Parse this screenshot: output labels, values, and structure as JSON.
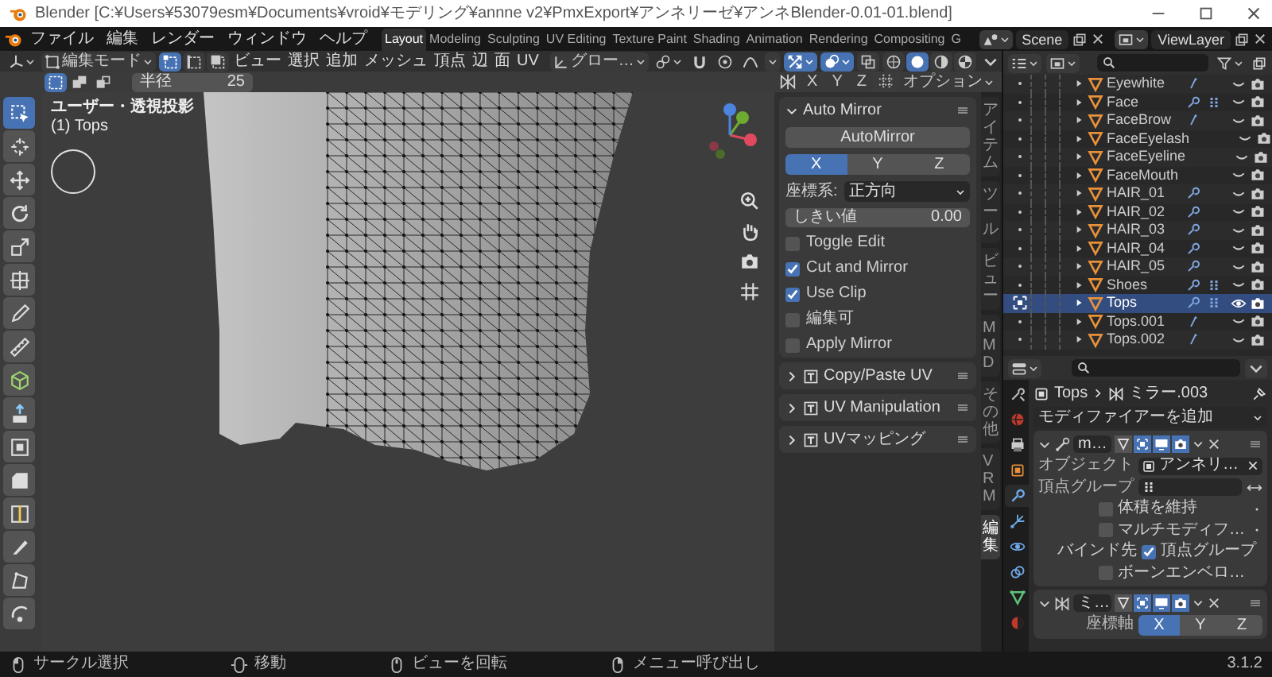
{
  "window": {
    "title": "Blender [C:¥Users¥53079esm¥Documents¥vroid¥モデリング¥annne v2¥PmxExport¥アンネリーゼ¥アンネBlender-0.01-01.blend]"
  },
  "menu": [
    "ファイル",
    "編集",
    "レンダー",
    "ウィンドウ",
    "ヘルプ"
  ],
  "workspaces": [
    {
      "label": "Layout",
      "selected": true
    },
    {
      "label": "Modeling",
      "selected": false
    },
    {
      "label": "Sculpting",
      "selected": false
    },
    {
      "label": "UV Editing",
      "selected": false
    },
    {
      "label": "Texture Paint",
      "selected": false
    },
    {
      "label": "Shading",
      "selected": false
    },
    {
      "label": "Animation",
      "selected": false
    },
    {
      "label": "Rendering",
      "selected": false
    },
    {
      "label": "Compositing",
      "selected": false
    },
    {
      "label": "G",
      "selected": false
    }
  ],
  "scene": "Scene",
  "view_layer": "ViewLayer",
  "viewport": {
    "mode": "編集モード",
    "select_modes": [
      {
        "kind": "vertex",
        "selected": true
      },
      {
        "kind": "edge",
        "selected": false
      },
      {
        "kind": "face",
        "selected": false
      }
    ],
    "menus": [
      "ビュー",
      "選択",
      "追加",
      "メッシュ",
      "頂点",
      "辺",
      "面",
      "UV"
    ],
    "orientation": "グロー…",
    "toggles": [
      {
        "kind": "visibility",
        "on": false
      },
      {
        "kind": "gizmo",
        "on": true
      },
      {
        "kind": "overlay",
        "on": true
      },
      {
        "kind": "xray",
        "on": false
      }
    ],
    "shading": [
      {
        "kind": "wireframe",
        "selected": false
      },
      {
        "kind": "solid",
        "selected": true
      },
      {
        "kind": "material",
        "selected": false
      },
      {
        "kind": "rendered",
        "selected": false
      }
    ],
    "box_modes": [
      {
        "kind": "new",
        "selected": true
      },
      {
        "kind": "extend",
        "selected": false
      },
      {
        "kind": "subtract",
        "selected": false
      }
    ],
    "radius": {
      "label": "半径",
      "value": "25"
    },
    "mirror_axes": [
      "X",
      "Y",
      "Z"
    ],
    "options": "オプション",
    "view_name": "ユーザー・透視投影",
    "object_name": "(1) Tops",
    "tools": [
      {
        "kind": "select-box",
        "selected": true
      },
      {
        "kind": "cursor",
        "selected": false
      },
      {
        "kind": "move",
        "selected": false
      },
      {
        "kind": "rotate",
        "selected": false
      },
      {
        "kind": "scale",
        "selected": false
      },
      {
        "kind": "transform",
        "selected": false
      },
      {
        "kind": "annotate",
        "selected": false
      },
      {
        "kind": "measure",
        "selected": false
      },
      {
        "kind": "add-cube",
        "selected": false
      },
      {
        "kind": "extrude",
        "selected": false
      },
      {
        "kind": "inset",
        "selected": false
      },
      {
        "kind": "bevel",
        "selected": false
      },
      {
        "kind": "loop-cut",
        "selected": false
      },
      {
        "kind": "knife",
        "selected": false
      },
      {
        "kind": "poly-build",
        "selected": false
      },
      {
        "kind": "spin",
        "selected": false
      }
    ]
  },
  "sidebar_tabs": [
    {
      "label": "アイテム",
      "selected": false
    },
    {
      "label": "ツール",
      "selected": false
    },
    {
      "label": "ビュー",
      "selected": false
    },
    {
      "label": "MMD",
      "selected": false
    },
    {
      "label": "その他",
      "selected": false
    },
    {
      "label": "VRM",
      "selected": false
    },
    {
      "label": "編集",
      "selected": true
    }
  ],
  "auto_mirror": {
    "title": "Auto Mirror",
    "expanded": true,
    "button": "AutoMirror",
    "axes": [
      {
        "label": "X",
        "selected": true
      },
      {
        "label": "Y",
        "selected": false
      },
      {
        "label": "Z",
        "selected": false
      }
    ],
    "orientation": {
      "label": "座標系:",
      "value": "正方向"
    },
    "threshold": {
      "label": "しきい値",
      "value": "0.00"
    },
    "options": [
      {
        "text": "Toggle Edit",
        "checked": false
      },
      {
        "text": "Cut and Mirror",
        "checked": true
      },
      {
        "text": "Use Clip",
        "checked": true
      },
      {
        "text": "編集可",
        "checked": false
      },
      {
        "text": "Apply Mirror",
        "checked": false
      }
    ]
  },
  "addon_panels": [
    {
      "title": "Copy/Paste UV",
      "expanded": false
    },
    {
      "title": "UV Manipulation",
      "expanded": false
    },
    {
      "title": "UVマッピング",
      "expanded": false
    }
  ],
  "outliner": {
    "rows": [
      {
        "name": "Eyewhite",
        "has_modifiers": false,
        "has_vertex_groups": false,
        "has_link": true,
        "visible": false,
        "selected": false
      },
      {
        "name": "Face",
        "has_modifiers": true,
        "has_vertex_groups": true,
        "has_link": false,
        "visible": false,
        "selected": false
      },
      {
        "name": "FaceBrow",
        "has_modifiers": false,
        "has_vertex_groups": false,
        "has_link": true,
        "visible": false,
        "selected": false
      },
      {
        "name": "FaceEyelash",
        "has_modifiers": false,
        "has_vertex_groups": false,
        "has_link": false,
        "visible": false,
        "selected": false
      },
      {
        "name": "FaceEyeline",
        "has_modifiers": false,
        "has_vertex_groups": false,
        "has_link": false,
        "visible": false,
        "selected": false
      },
      {
        "name": "FaceMouth",
        "has_modifiers": false,
        "has_vertex_groups": false,
        "has_link": false,
        "visible": false,
        "selected": false
      },
      {
        "name": "HAIR_01",
        "has_modifiers": true,
        "has_vertex_groups": false,
        "has_link": false,
        "visible": false,
        "selected": false
      },
      {
        "name": "HAIR_02",
        "has_modifiers": true,
        "has_vertex_groups": false,
        "has_link": false,
        "visible": false,
        "selected": false
      },
      {
        "name": "HAIR_03",
        "has_modifiers": true,
        "has_vertex_groups": false,
        "has_link": false,
        "visible": false,
        "selected": false
      },
      {
        "name": "HAIR_04",
        "has_modifiers": true,
        "has_vertex_groups": false,
        "has_link": false,
        "visible": false,
        "selected": false
      },
      {
        "name": "HAIR_05",
        "has_modifiers": true,
        "has_vertex_groups": false,
        "has_link": false,
        "visible": false,
        "selected": false
      },
      {
        "name": "Shoes",
        "has_modifiers": true,
        "has_vertex_groups": true,
        "has_link": false,
        "visible": false,
        "selected": false
      },
      {
        "name": "Tops",
        "has_modifiers": true,
        "has_vertex_groups": true,
        "has_link": false,
        "visible": true,
        "selected": true
      },
      {
        "name": "Tops.001",
        "has_modifiers": false,
        "has_vertex_groups": false,
        "has_link": true,
        "visible": false,
        "selected": false
      },
      {
        "name": "Tops.002",
        "has_modifiers": false,
        "has_vertex_groups": false,
        "has_link": true,
        "visible": false,
        "selected": false
      }
    ]
  },
  "properties": {
    "tabs": [
      {
        "kind": "tool",
        "selected": false
      },
      {
        "kind": "scene",
        "selected": false
      },
      {
        "kind": "output",
        "selected": false
      },
      {
        "kind": "object",
        "selected": false
      },
      {
        "kind": "modifier",
        "selected": true
      },
      {
        "kind": "particles",
        "selected": false
      },
      {
        "kind": "physics",
        "selected": false
      },
      {
        "kind": "constraints",
        "selected": false
      },
      {
        "kind": "data",
        "selected": false
      },
      {
        "kind": "material",
        "selected": false
      }
    ],
    "breadcrumb": [
      "Tops",
      "ミラー.003"
    ],
    "add_modifier": "モディファイアーを追加",
    "modifiers": [
      {
        "kind": "armature",
        "name": "m…",
        "expanded": true,
        "toggles": [
          {
            "kind": "edit-mode",
            "on": false
          },
          {
            "kind": "cage",
            "on": true
          },
          {
            "kind": "viewport",
            "on": true
          },
          {
            "kind": "render",
            "on": true
          }
        ],
        "rows": [
          {
            "kind": "object-field",
            "label": "オブジェクト",
            "value": "アンネリ…"
          },
          {
            "kind": "group-field",
            "label": "頂点グループ"
          },
          {
            "kind": "checkbox",
            "text": "体積を維持",
            "checked": false,
            "keyframe_dot": true
          },
          {
            "kind": "checkbox",
            "text": "マルチモディフ…",
            "checked": false,
            "keyframe_dot": true
          },
          {
            "kind": "checkbox",
            "label": "バインド先",
            "text": "頂点グループ",
            "checked": true
          },
          {
            "kind": "checkbox",
            "text": "ボーンエンベロ…",
            "checked": false
          }
        ]
      },
      {
        "kind": "mirror",
        "name": "ミ…",
        "expanded": true,
        "toggles": [
          {
            "kind": "edit-mode",
            "on": false
          },
          {
            "kind": "cage",
            "on": true
          },
          {
            "kind": "viewport",
            "on": true
          },
          {
            "kind": "render",
            "on": true
          }
        ],
        "rows": [
          {
            "kind": "axes",
            "label": "座標軸",
            "axes": [
              {
                "label": "X",
                "selected": true
              },
              {
                "label": "Y",
                "selected": false
              },
              {
                "label": "Z",
                "selected": false
              }
            ]
          }
        ]
      }
    ]
  },
  "status_bar": {
    "items": [
      {
        "kind": "mouse-left",
        "label": "サークル選択"
      },
      {
        "kind": "mouse-move",
        "label": "移動"
      },
      {
        "kind": "mouse-middle",
        "label": "ビューを回転"
      },
      {
        "kind": "mouse-right",
        "label": "メニュー呼び出し"
      }
    ],
    "version": "3.1.2"
  }
}
